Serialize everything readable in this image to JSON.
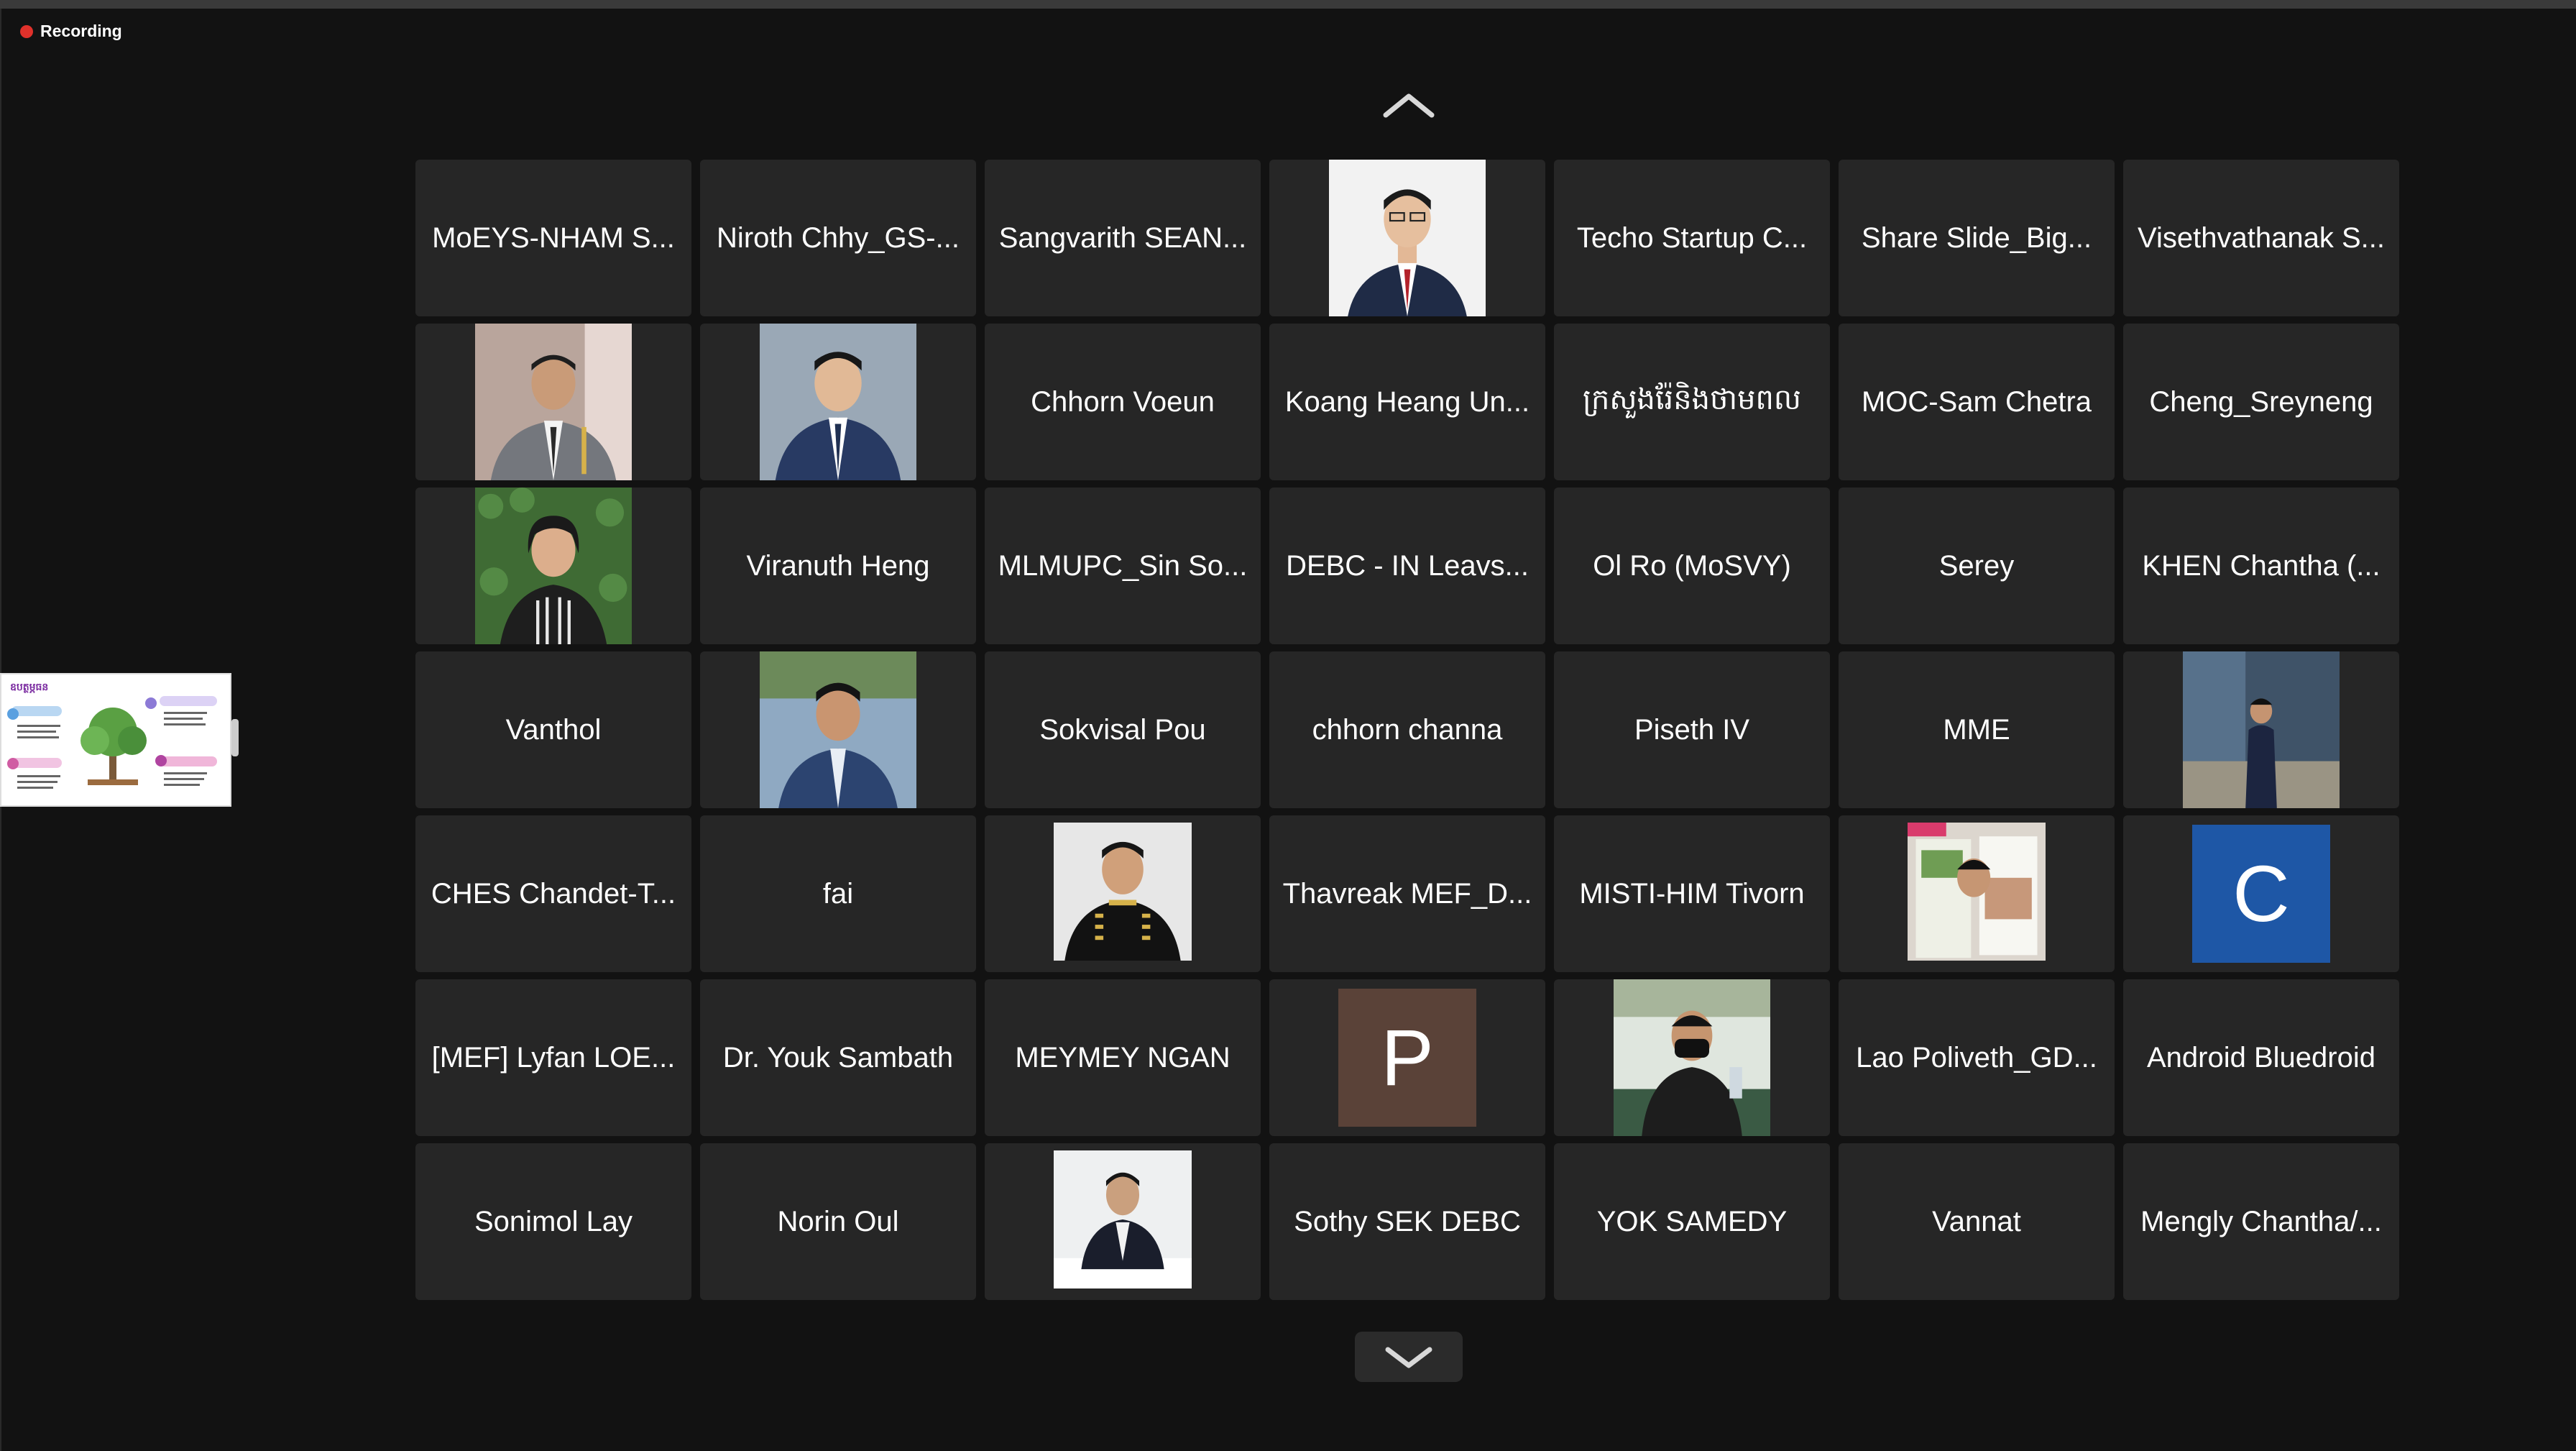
{
  "recording": {
    "label": "Recording"
  },
  "share": {
    "title": "ឧបត្ថម្ភធន"
  },
  "colors": {
    "tile_bg": "#262626",
    "record_red": "#e0312b",
    "avatar_p": "#5a4238",
    "avatar_c": "#1e57a6"
  },
  "navigation": {
    "up_icon": "chevron-up-icon",
    "down_icon": "chevron-down-icon"
  },
  "participants": [
    {
      "name": "MoEYS-NHAM S..."
    },
    {
      "name": "Niroth Chhy_GS-..."
    },
    {
      "name": "Sangvarith SEAN..."
    },
    {
      "name": "",
      "image": "portrait-red-tie"
    },
    {
      "name": "Techo Startup C..."
    },
    {
      "name": "Share Slide_Big..."
    },
    {
      "name": "Visethvathanak S..."
    },
    {
      "name": "",
      "image": "portrait-gray-suit"
    },
    {
      "name": "",
      "image": "portrait-blue-suit"
    },
    {
      "name": "Chhorn Voeun"
    },
    {
      "name": "Koang Heang Un..."
    },
    {
      "name": "ក្រសួងរ៉ែនិងថាមពល"
    },
    {
      "name": "MOC-Sam Chetra"
    },
    {
      "name": "Cheng_Sreyneng"
    },
    {
      "name": "",
      "image": "portrait-woman-hedge"
    },
    {
      "name": "Viranuth Heng"
    },
    {
      "name": "MLMUPC_Sin So..."
    },
    {
      "name": "DEBC - IN Leavs..."
    },
    {
      "name": "Ol Ro (MoSVY)"
    },
    {
      "name": "Serey"
    },
    {
      "name": "KHEN Chantha (..."
    },
    {
      "name": "Vanthol"
    },
    {
      "name": "",
      "image": "portrait-outdoor"
    },
    {
      "name": "Sokvisal Pou"
    },
    {
      "name": "chhorn channa"
    },
    {
      "name": "Piseth IV"
    },
    {
      "name": "MME"
    },
    {
      "name": "",
      "image": "portrait-standing"
    },
    {
      "name": "CHES Chandet-T..."
    },
    {
      "name": "fai"
    },
    {
      "name": "",
      "image": "portrait-uniform"
    },
    {
      "name": "Thavreak MEF_D..."
    },
    {
      "name": "MISTI-HIM Tivorn"
    },
    {
      "name": "",
      "image": "portrait-magazine"
    },
    {
      "name": "",
      "avatar": "C"
    },
    {
      "name": "[MEF] Lyfan LOE..."
    },
    {
      "name": "Dr. Youk Sambath"
    },
    {
      "name": "MEYMEY NGAN"
    },
    {
      "name": "",
      "avatar": "P"
    },
    {
      "name": "",
      "image": "portrait-masked-desk"
    },
    {
      "name": "Lao Poliveth_GD..."
    },
    {
      "name": "Android Bluedroid"
    },
    {
      "name": "Sonimol Lay"
    },
    {
      "name": "Norin Oul"
    },
    {
      "name": "",
      "image": "portrait-seated-desk"
    },
    {
      "name": "Sothy SEK DEBC"
    },
    {
      "name": "YOK SAMEDY"
    },
    {
      "name": "Vannat"
    },
    {
      "name": "Mengly Chantha/..."
    }
  ]
}
